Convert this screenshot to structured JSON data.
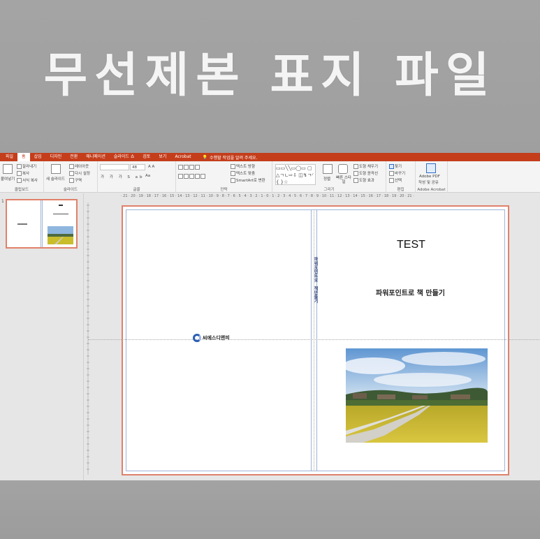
{
  "banner": {
    "title": "무선제본 표지 파일"
  },
  "tabs": [
    {
      "label": "파일",
      "active": false
    },
    {
      "label": "홈",
      "active": true
    },
    {
      "label": "삽입",
      "active": false
    },
    {
      "label": "디자인",
      "active": false
    },
    {
      "label": "전환",
      "active": false
    },
    {
      "label": "애니메이션",
      "active": false
    },
    {
      "label": "슬라이드 쇼",
      "active": false
    },
    {
      "label": "검토",
      "active": false
    },
    {
      "label": "보기",
      "active": false
    },
    {
      "label": "Acrobat",
      "active": false
    }
  ],
  "tell_me": "수행할 작업을 알려 주세요.",
  "ribbon": {
    "clipboard": {
      "paste": "붙여넣기",
      "cut": "잘라내기",
      "copy": "복사",
      "format_painter": "서식 복사",
      "label": "클립보드"
    },
    "slides": {
      "new_slide": "새 슬라이드",
      "layout": "레이아웃",
      "reset": "다시 설정",
      "section": "구역",
      "label": "슬라이드"
    },
    "font": {
      "size": "48",
      "label": "글꼴",
      "aa": "Aa"
    },
    "paragraph": {
      "text_direction": "텍스트 방향",
      "align_text": "텍스트 맞춤",
      "smartart": "SmartArt로 변환",
      "label": "단락"
    },
    "drawing": {
      "arrange": "정렬",
      "quick_styles": "빠른 스타일",
      "shape_fill": "도형 채우기",
      "shape_outline": "도형 윤곽선",
      "shape_effects": "도형 효과",
      "label": "그리기"
    },
    "editing": {
      "find": "찾기",
      "replace": "바꾸기",
      "select": "선택",
      "label": "편집"
    },
    "acrobat": {
      "create": "Adobe PDF",
      "create2": "작성 및 공유",
      "label": "Adobe Acrobat"
    }
  },
  "thumbnail": {
    "number": "1"
  },
  "ruler": {
    "text": "· 21 · 20 · 19 · 18 · 17 · 16 · 15 · 14 · 13 · 12 · 11 · 10 · 9 · 8 · 7 · 6 · 5 · 4 · 3 · 2 · 1 · 0 · 1 · 2 · 3 · 4 · 5 · 6 · 7 · 8 · 9 · 10 · 11 · 12 · 13 · 14 · 15 · 16 · 17 · 18 · 19 · 20 · 21 ·"
  },
  "slide": {
    "title": "TEST",
    "subtitle": "파워포인트로 책 만들기",
    "spine_title": "파워포인트로",
    "spine_author": "책만들기",
    "logo_text": "씨에스디앤피"
  }
}
